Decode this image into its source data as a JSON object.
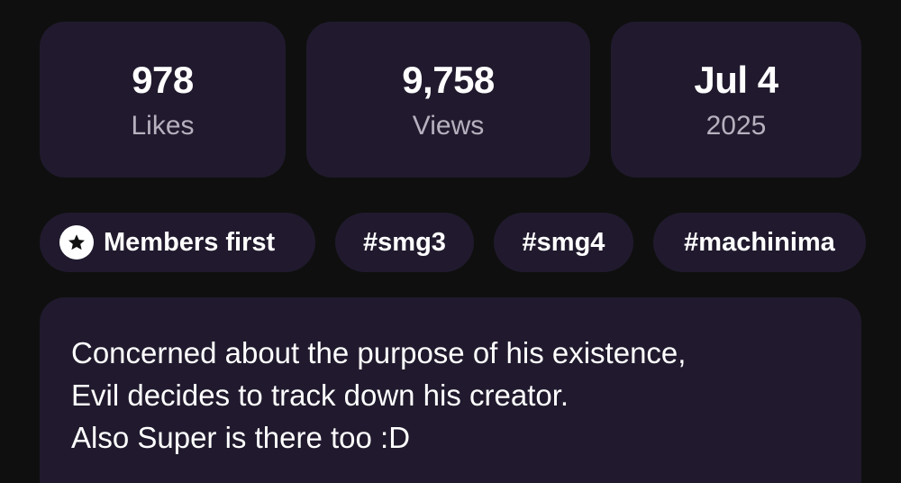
{
  "stats": [
    {
      "value": "978",
      "label": "Likes"
    },
    {
      "value": "9,758",
      "label": "Views"
    },
    {
      "value": "Jul 4",
      "label": "2025"
    }
  ],
  "chips": {
    "members": {
      "label": "Members first",
      "icon": "star-icon"
    },
    "tags": [
      "#smg3",
      "#smg4",
      "#machinima"
    ]
  },
  "description": {
    "lines": [
      "Concerned about the purpose of his existence,",
      "Evil decides to track down his creator.",
      "Also Super is there too :D"
    ]
  },
  "colors": {
    "background": "#0f0f0f",
    "card": "#211a2e",
    "muted_text": "#b6b0bf"
  }
}
